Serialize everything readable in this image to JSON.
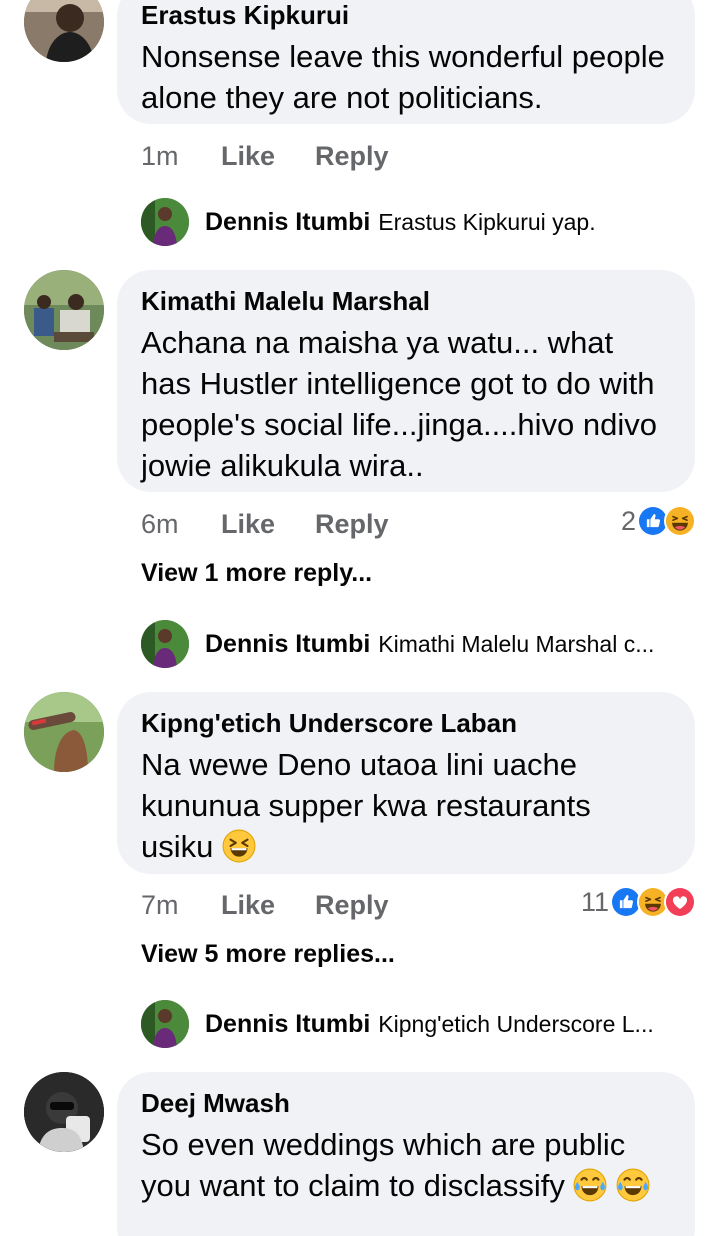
{
  "comments": [
    {
      "author": "Erastus Kipkurui",
      "text": "Nonsense leave this wonderful people alone they are not politicians.",
      "time": "1m",
      "like": "Like",
      "reply": "Reply",
      "reply_preview": {
        "author": "Dennis Itumbi",
        "text": "Erastus Kipkurui yap."
      }
    },
    {
      "author": "Kimathi Malelu Marshal",
      "text": "Achana na maisha ya watu... what has Hustler intelligence got to do with people's social life...jinga....hivo ndivo jowie alikukula wira..",
      "time": "6m",
      "like": "Like",
      "reply": "Reply",
      "reaction_count": "2",
      "reactions": [
        "like-icon",
        "haha-icon"
      ],
      "view_more": "View 1 more reply...",
      "reply_preview": {
        "author": "Dennis Itumbi",
        "text": "Kimathi Malelu Marshal c..."
      }
    },
    {
      "author": "Kipng'etich Underscore Laban",
      "text": "Na wewe Deno utaoa lini uache kununua supper kwa restaurants usiku",
      "time": "7m",
      "like": "Like",
      "reply": "Reply",
      "reaction_count": "11",
      "reactions": [
        "like-icon",
        "haha-icon",
        "love-icon"
      ],
      "view_more": "View 5 more replies...",
      "reply_preview": {
        "author": "Dennis Itumbi",
        "text": "Kipng'etich Underscore L..."
      }
    },
    {
      "author": "Deej Mwash",
      "text": "So even weddings which are public you want to claim to disclassify"
    }
  ],
  "colors": {
    "bubble": "#f0f2f5",
    "meta": "#65676b",
    "like_blue": "#1877f2",
    "love_red": "#f33e58",
    "haha_yellow": "#f7b125"
  }
}
